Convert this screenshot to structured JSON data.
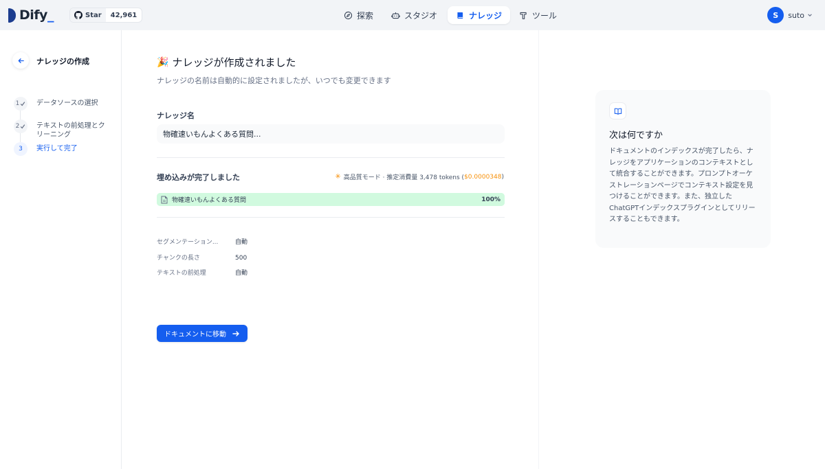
{
  "brand": {
    "name": "Dify",
    "accent": "#155eef"
  },
  "github": {
    "star_label": "Star",
    "count": "42,961"
  },
  "nav": {
    "explore": "探索",
    "studio": "スタジオ",
    "knowledge": "ナレッジ",
    "tools": "ツール"
  },
  "user": {
    "initial": "S",
    "name": "suto"
  },
  "sidebar": {
    "title": "ナレッジの作成",
    "steps": [
      {
        "num": "1",
        "label": "データソースの選択",
        "state": "done"
      },
      {
        "num": "2",
        "label": "テキストの前処理とクリーニング",
        "state": "done"
      },
      {
        "num": "3",
        "label": "実行して完了",
        "state": "active"
      }
    ]
  },
  "main": {
    "title": "ナレッジが作成されました",
    "subtitle": "ナレッジの名前は自動的に設定されましたが、いつでも変更できます",
    "name_label": "ナレッジ名",
    "name_value": "物確速いもんよくある質問...",
    "embed_title": "埋め込みが完了しました",
    "mode_text": "高品質モード · 推定消費量 3,478 tokens (",
    "mode_price": "$0.0000348",
    "mode_close": ")",
    "file": {
      "name": "物確速いもんよくある質問",
      "progress_label": "100%",
      "progress": 1.0
    },
    "stats": [
      {
        "key": "セグメンテーション...",
        "value": "自動"
      },
      {
        "key": "チャンクの長さ",
        "value": "500"
      },
      {
        "key": "テキストの前処理",
        "value": "自動"
      }
    ],
    "go_button": "ドキュメントに移動"
  },
  "card": {
    "title": "次は何ですか",
    "body": "ドキュメントのインデックスが完了したら、ナレッジをアプリケーションのコンテキストとして統合することができます。プロンプトオーケストレーションページでコンテキスト設定を見つけることができます。また、独立したChatGPTインデックスプラグインとしてリリースすることもできます。"
  },
  "icons": {
    "nav_explore": "compass-icon",
    "nav_studio": "robot-icon",
    "nav_knowledge": "book-icon",
    "nav_tools": "hammer-icon",
    "back": "arrow-left-icon",
    "file": "file-icon",
    "card": "open-book-icon"
  }
}
